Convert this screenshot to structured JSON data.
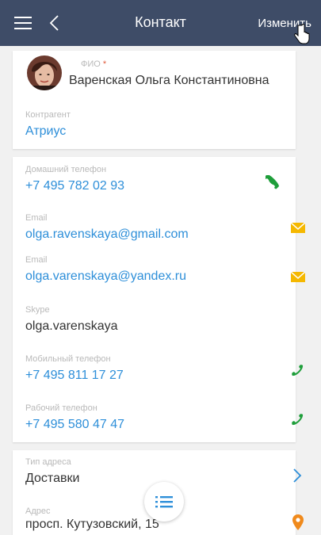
{
  "header": {
    "title": "Контакт",
    "edit_label": "Изменить"
  },
  "profile": {
    "fio_label": "ФИО",
    "required_mark": "*",
    "fio_value": "Варенская Ольга Константиновна",
    "contractor_label": "Контрагент",
    "contractor_value": "Атриус"
  },
  "communications": [
    {
      "label": "Домашний телефон",
      "value": "+7 495 782 02 93",
      "icon": "phone-icon"
    },
    {
      "label": "Email",
      "value": "olga.ravenskaya@gmail.com",
      "icon": "mail-icon"
    },
    {
      "label": "Email",
      "value": "olga.varenskaya@yandex.ru",
      "icon": "mail-icon"
    },
    {
      "label": "Skype",
      "value": "olga.varenskaya",
      "icon": ""
    },
    {
      "label": "Мобильный телефон",
      "value": "+7 495 811 17 27",
      "icon": "phone-icon"
    },
    {
      "label": "Рабочий телефон",
      "value": "+7 495 580 47 47",
      "icon": "phone-icon"
    }
  ],
  "address": {
    "type_label": "Тип адреса",
    "type_value": "Доставки",
    "address_label": "Адрес",
    "address_value": "просп. Кутузовский, 15"
  },
  "colors": {
    "header_bg": "#3e4c67",
    "link": "#2e8fd9",
    "phone_icon": "#1e9e3a",
    "mail_icon": "#f5b800",
    "map_icon": "#f08a1c",
    "fab_icon": "#2e8fd9"
  }
}
